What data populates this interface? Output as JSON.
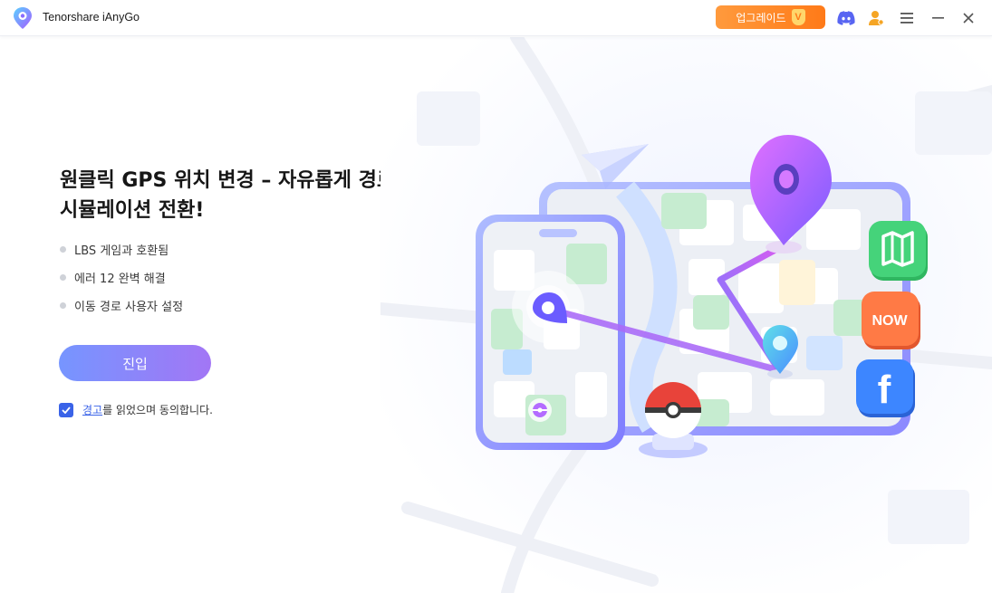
{
  "window": {
    "app_title": "Tenorshare iAnyGo",
    "upgrade_label": "업그레이드",
    "vip_badge": "V",
    "icons": [
      "discord-icon",
      "account-icon",
      "menu-icon",
      "minimize-icon",
      "close-icon"
    ]
  },
  "main": {
    "headline_line1": "원클릭 GPS 위치 변경 – 자유롭게 경로",
    "headline_line2": "시뮬레이션 전환!",
    "features": [
      "LBS 게임과 호환됨",
      "에러 12 완벽 해결",
      "이동 경로 사용자 설정"
    ],
    "enter_label": "진입",
    "agree_link": "경고",
    "agree_rest": "를 읽었으며 동의합니다.",
    "agree_checked": true
  },
  "illustration": {
    "app_badges": [
      "map-app-icon",
      "now-app-icon",
      "facebook-app-icon"
    ],
    "now_text": "NOW",
    "facebook_text": "f"
  },
  "colors": {
    "accent": "#3a63e8",
    "upgrade": "#ff7a18",
    "enter_gradient_start": "#6a8cff",
    "enter_gradient_end": "#9b6bf5"
  }
}
